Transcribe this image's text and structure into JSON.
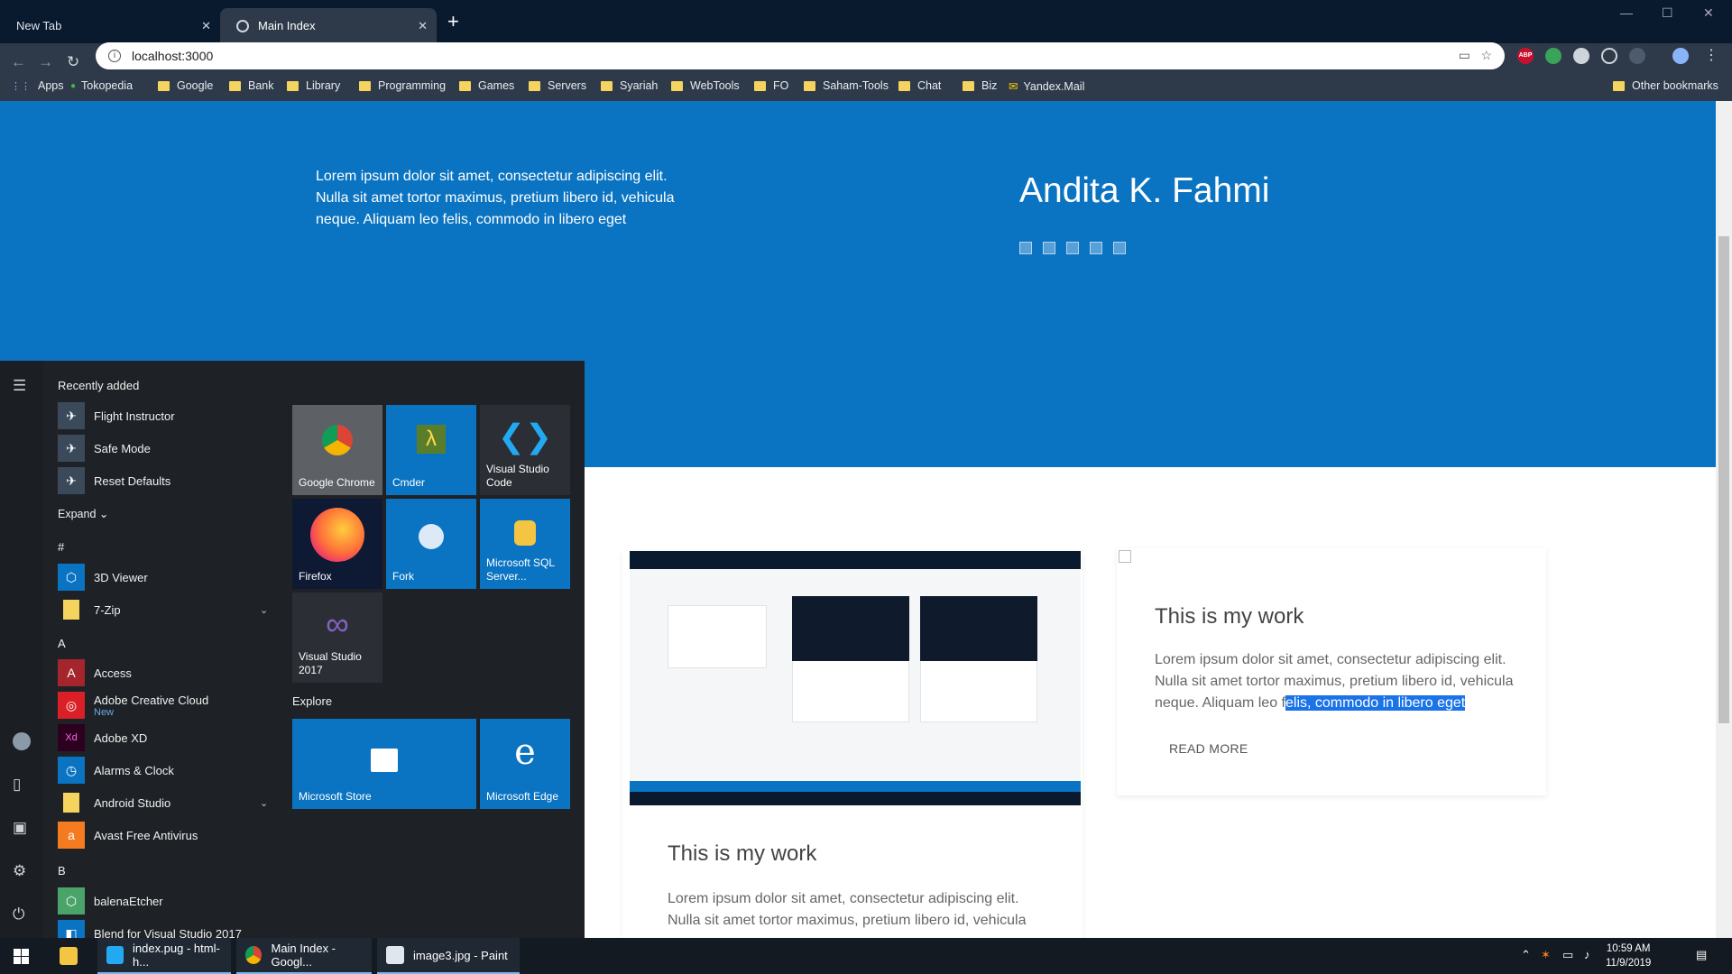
{
  "browser": {
    "tabs": [
      {
        "title": "New Tab",
        "active": false
      },
      {
        "title": "Main Index",
        "active": true
      }
    ],
    "new_tab_symbol": "+",
    "url": "localhost:3000",
    "bookmarks": [
      {
        "label": "Apps",
        "icon": "apps-grid-icon"
      },
      {
        "label": "Tokopedia",
        "icon": "tokopedia-icon"
      },
      {
        "label": "Google",
        "icon": "folder-icon"
      },
      {
        "label": "Bank",
        "icon": "folder-icon"
      },
      {
        "label": "Library",
        "icon": "folder-icon"
      },
      {
        "label": "Programming",
        "icon": "folder-icon"
      },
      {
        "label": "Games",
        "icon": "folder-icon"
      },
      {
        "label": "Servers",
        "icon": "folder-icon"
      },
      {
        "label": "Syariah",
        "icon": "folder-icon"
      },
      {
        "label": "WebTools",
        "icon": "folder-icon"
      },
      {
        "label": "FO",
        "icon": "folder-icon"
      },
      {
        "label": "Saham-Tools",
        "icon": "folder-icon"
      },
      {
        "label": "Chat",
        "icon": "folder-icon"
      },
      {
        "label": "Biz",
        "icon": "folder-icon"
      },
      {
        "label": "Yandex.Mail",
        "icon": "mail-icon"
      }
    ],
    "other_bookmarks": "Other bookmarks",
    "extension_badge": "ABP"
  },
  "page": {
    "hero_text": "Lorem ipsum dolor sit amet, consectetur adipiscing elit. Nulla sit amet tortor maximus, pretium libero id, vehicula neque. Aliquam leo felis, commodo in libero eget",
    "hero_name": "Andita K. Fahmi",
    "card1": {
      "title": "This is my work",
      "text": "Lorem ipsum dolor sit amet, consectetur adipiscing elit. Nulla sit amet tortor maximus, pretium libero id, vehicula"
    },
    "card2": {
      "title": "This is my work",
      "text_before": "Lorem ipsum dolor sit amet, consectetur adipiscing elit. Nulla sit amet tortor maximus, pretium libero id, vehicula neque. Aliquam leo f",
      "text_selected": "elis, commodo in libero eget",
      "read_more": "READ MORE"
    }
  },
  "start_menu": {
    "recently_added": "Recently added",
    "recent": [
      "Flight Instructor",
      "Safe Mode",
      "Reset Defaults"
    ],
    "expand": "Expand",
    "sections": {
      "hash": "#",
      "a": "A",
      "b": "B"
    },
    "hash_apps": [
      "3D Viewer",
      "7-Zip"
    ],
    "a_apps": [
      "Access",
      "Adobe Creative Cloud",
      "Adobe XD",
      "Alarms & Clock",
      "Android Studio",
      "Avast Free Antivirus"
    ],
    "adobe_cc_sub": "New",
    "b_apps": [
      "balenaEtcher",
      "Blend for Visual Studio 2017"
    ],
    "tiles": [
      "Google Chrome",
      "Cmder",
      "Visual Studio Code",
      "Firefox",
      "Fork",
      "Microsoft SQL Server...",
      "Visual Studio 2017"
    ],
    "explore_label": "Explore",
    "explore_tiles": [
      "Microsoft Store",
      "Microsoft Edge"
    ]
  },
  "taskbar": {
    "items": [
      "index.pug - html-h...",
      "Main Index - Googl...",
      "image3.jpg - Paint"
    ],
    "time": "10:59 AM",
    "date": "11/9/2019"
  }
}
